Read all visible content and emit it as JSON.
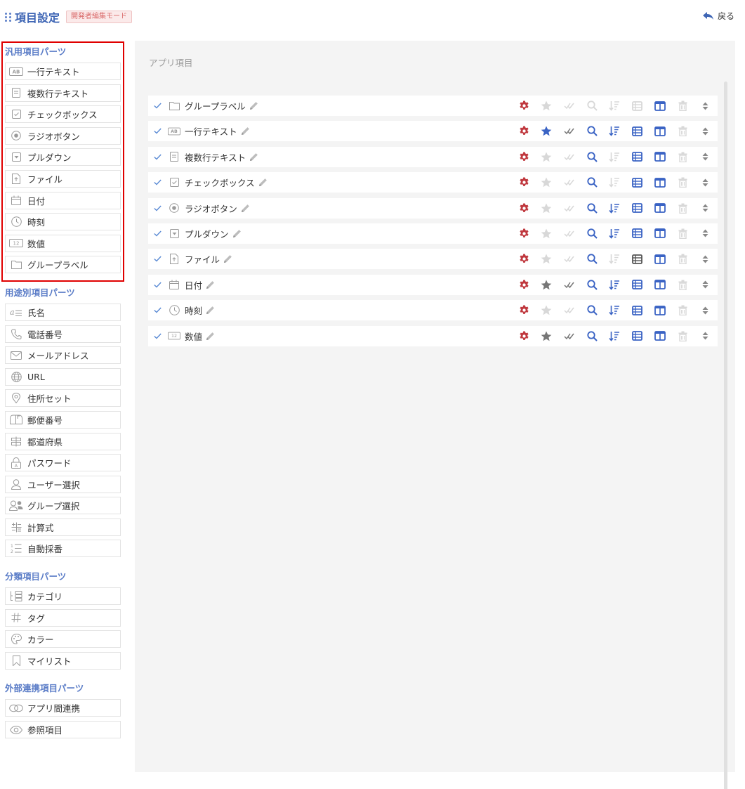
{
  "header": {
    "title": "項目設定",
    "mode_badge": "開発者編集モード",
    "back_label": "戻る"
  },
  "sidebar": {
    "sections": [
      {
        "title": "汎用項目パーツ",
        "items": [
          {
            "label": "一行テキスト",
            "icon": "text-ab-icon"
          },
          {
            "label": "複数行テキスト",
            "icon": "document-icon"
          },
          {
            "label": "チェックボックス",
            "icon": "checkbox-icon"
          },
          {
            "label": "ラジオボタン",
            "icon": "radio-icon"
          },
          {
            "label": "プルダウン",
            "icon": "dropdown-icon"
          },
          {
            "label": "ファイル",
            "icon": "file-upload-icon"
          },
          {
            "label": "日付",
            "icon": "calendar-icon"
          },
          {
            "label": "時刻",
            "icon": "clock-icon"
          },
          {
            "label": "数値",
            "icon": "number-icon"
          },
          {
            "label": "グループラベル",
            "icon": "folder-icon"
          }
        ]
      },
      {
        "title": "用途別項目パーツ",
        "items": [
          {
            "label": "氏名",
            "icon": "name-icon"
          },
          {
            "label": "電話番号",
            "icon": "phone-icon"
          },
          {
            "label": "メールアドレス",
            "icon": "mail-icon"
          },
          {
            "label": "URL",
            "icon": "globe-icon"
          },
          {
            "label": "住所セット",
            "icon": "location-pin-icon"
          },
          {
            "label": "郵便番号",
            "icon": "postbox-icon"
          },
          {
            "label": "都道府県",
            "icon": "prefecture-icon"
          },
          {
            "label": "パスワード",
            "icon": "lock-icon"
          },
          {
            "label": "ユーザー選択",
            "icon": "user-icon"
          },
          {
            "label": "グループ選択",
            "icon": "group-icon"
          },
          {
            "label": "計算式",
            "icon": "calculator-icon"
          },
          {
            "label": "自動採番",
            "icon": "numbered-list-icon"
          }
        ]
      },
      {
        "title": "分類項目パーツ",
        "items": [
          {
            "label": "カテゴリ",
            "icon": "category-tree-icon"
          },
          {
            "label": "タグ",
            "icon": "hash-icon"
          },
          {
            "label": "カラー",
            "icon": "palette-icon"
          },
          {
            "label": "マイリスト",
            "icon": "bookmark-icon"
          }
        ]
      },
      {
        "title": "外部連携項目パーツ",
        "items": [
          {
            "label": "アプリ間連携",
            "icon": "link-icon"
          },
          {
            "label": "参照項目",
            "icon": "eye-icon"
          }
        ]
      }
    ]
  },
  "main": {
    "title": "アプリ項目",
    "fields": [
      {
        "label": "グループラベル",
        "icon": "folder-icon",
        "star": false,
        "check": false,
        "search": false,
        "sort": false,
        "list": false
      },
      {
        "label": "一行テキスト",
        "icon": "text-ab-icon",
        "star": "blue",
        "check": true,
        "search": true,
        "sort": true,
        "list": true
      },
      {
        "label": "複数行テキスト",
        "icon": "document-icon",
        "star": false,
        "check": false,
        "search": true,
        "sort": false,
        "list": true
      },
      {
        "label": "チェックボックス",
        "icon": "checkbox-icon",
        "star": false,
        "check": false,
        "search": true,
        "sort": false,
        "list": true
      },
      {
        "label": "ラジオボタン",
        "icon": "radio-icon",
        "star": false,
        "check": false,
        "search": true,
        "sort": true,
        "list": true
      },
      {
        "label": "プルダウン",
        "icon": "dropdown-icon",
        "star": false,
        "check": false,
        "search": true,
        "sort": true,
        "list": true
      },
      {
        "label": "ファイル",
        "icon": "file-upload-icon",
        "star": false,
        "check": false,
        "search": true,
        "sort": false,
        "list": "dark"
      },
      {
        "label": "日付",
        "icon": "calendar-icon",
        "star": "dark",
        "check": true,
        "search": true,
        "sort": true,
        "list": true
      },
      {
        "label": "時刻",
        "icon": "clock-icon",
        "star": false,
        "check": false,
        "search": true,
        "sort": true,
        "list": true
      },
      {
        "label": "数値",
        "icon": "number-icon",
        "star": "dark",
        "check": true,
        "search": true,
        "sort": true,
        "list": true
      }
    ]
  },
  "colors": {
    "accent": "#3f66b5",
    "gear": "#c0393f",
    "active_blue": "#3a63c4",
    "inactive": "#d5d5d5",
    "highlight_border": "#e00000"
  }
}
